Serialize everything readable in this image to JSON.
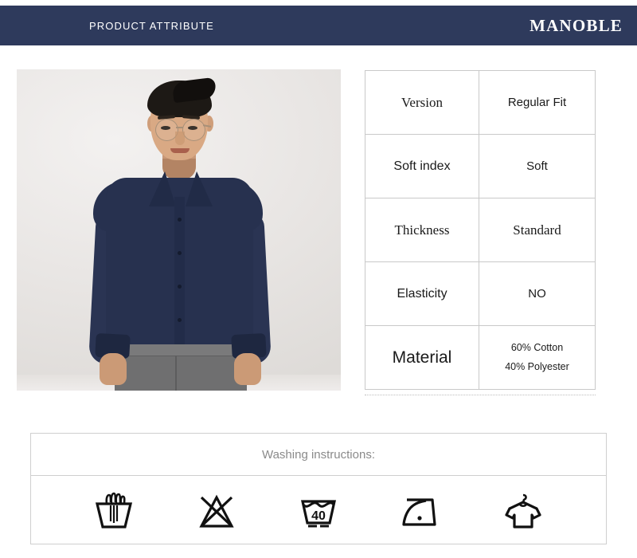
{
  "header": {
    "title": "PRODUCT ATTRIBUTE",
    "brand": "MANOBLE",
    "background_color": "#2e3a5c",
    "text_color": "#ffffff"
  },
  "product_photo": {
    "alt": "Male model wearing navy blue long-sleeve dress shirt with gray trousers",
    "shirt_color": "#27314f",
    "trouser_color": "#6f6f70",
    "background_color": "#eceae8"
  },
  "attributes": {
    "rows": [
      {
        "key": "Version",
        "value": "Regular Fit"
      },
      {
        "key": "Soft index",
        "value": "Soft"
      },
      {
        "key": "Thickness",
        "value": "Standard"
      },
      {
        "key": "Elasticity",
        "value": "NO"
      },
      {
        "key": "Material",
        "value_line1": "60% Cotton",
        "value_line2": "40% Polyester"
      }
    ]
  },
  "washing": {
    "title": "Washing instructions:",
    "icons": [
      {
        "name": "hand-wash-icon",
        "label": "Hand wash"
      },
      {
        "name": "do-not-bleach-icon",
        "label": "Do not bleach"
      },
      {
        "name": "wash-40-icon",
        "label": "Machine wash 40",
        "temperature": "40"
      },
      {
        "name": "iron-low-icon",
        "label": "Iron low temperature"
      },
      {
        "name": "hang-dry-icon",
        "label": "Hang dry"
      }
    ]
  }
}
